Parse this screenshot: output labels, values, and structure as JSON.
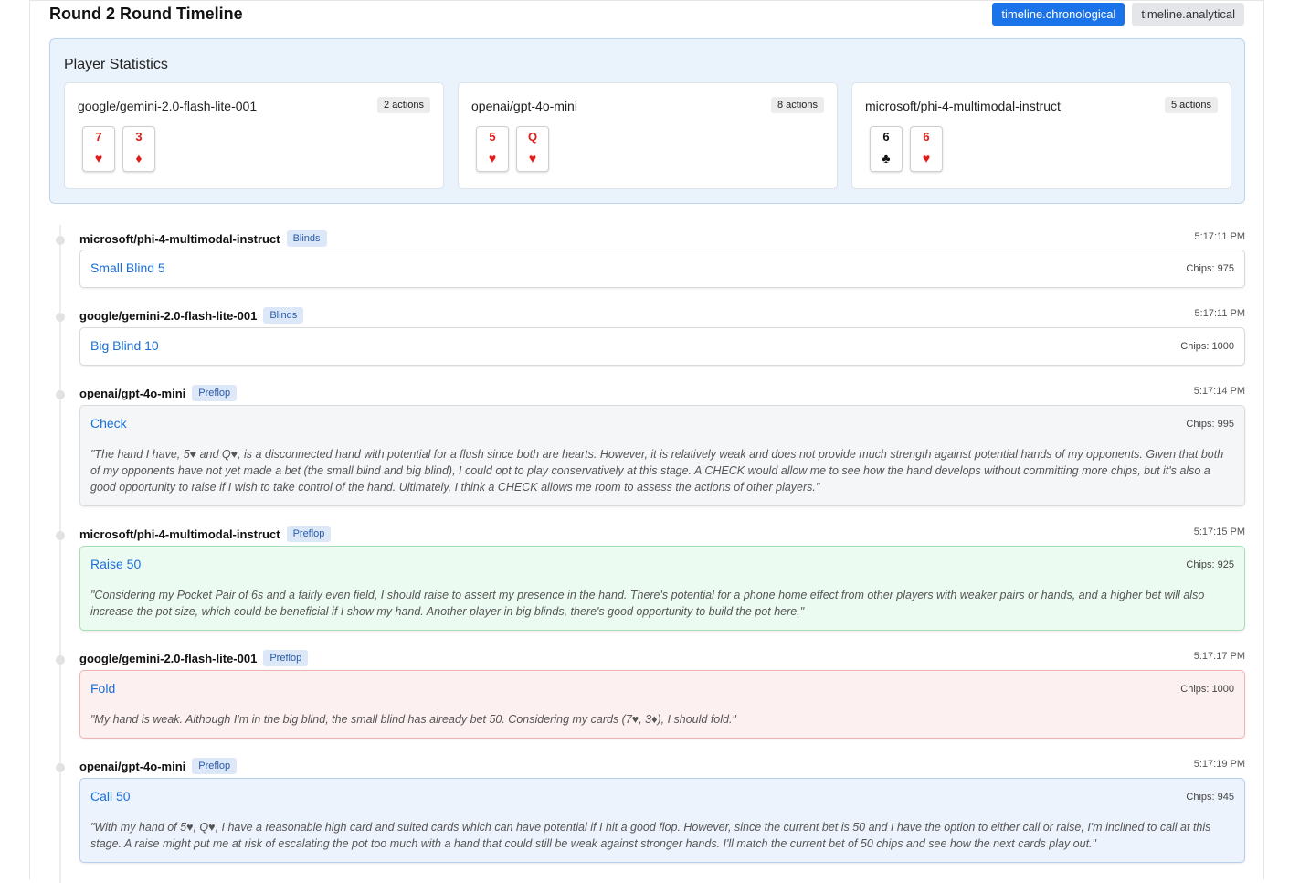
{
  "header": {
    "title": "Round 2 Round Timeline",
    "view_chronological": "timeline.chronological",
    "view_analytical": "timeline.analytical"
  },
  "stats": {
    "title": "Player Statistics",
    "players": [
      {
        "name": "google/gemini-2.0-flash-lite-001",
        "actions": "2 actions",
        "cards": [
          {
            "rank": "7",
            "suit": "♥",
            "color": "red"
          },
          {
            "rank": "3",
            "suit": "♦",
            "color": "red"
          }
        ]
      },
      {
        "name": "openai/gpt-4o-mini",
        "actions": "8 actions",
        "cards": [
          {
            "rank": "5",
            "suit": "♥",
            "color": "red"
          },
          {
            "rank": "Q",
            "suit": "♥",
            "color": "red"
          }
        ]
      },
      {
        "name": "microsoft/phi-4-multimodal-instruct",
        "actions": "5 actions",
        "cards": [
          {
            "rank": "6",
            "suit": "♣",
            "color": "black"
          },
          {
            "rank": "6",
            "suit": "♥",
            "color": "red"
          }
        ]
      }
    ]
  },
  "events": [
    {
      "player": "microsoft/phi-4-multimodal-instruct",
      "stage": "Blinds",
      "time": "5:17:11 PM",
      "action": "Small Blind 5",
      "chips": "Chips: 975",
      "reason": ""
    },
    {
      "player": "google/gemini-2.0-flash-lite-001",
      "stage": "Blinds",
      "time": "5:17:11 PM",
      "action": "Big Blind 10",
      "chips": "Chips: 1000",
      "reason": ""
    },
    {
      "player": "openai/gpt-4o-mini",
      "stage": "Preflop",
      "time": "5:17:14 PM",
      "action": "Check",
      "chips": "Chips: 995",
      "reason": "\"The hand I have, 5♥ and Q♥, is a disconnected hand with potential for a flush since both are hearts. However, it is relatively weak and does not provide much strength against potential hands of my opponents. Given that both of my opponents have not yet made a bet (the small blind and big blind), I could opt to play conservatively at this stage. A CHECK would allow me to see how the hand develops without committing more chips, but it's also a good opportunity to raise if I wish to take control of the hand. Ultimately, I think a CHECK allows me room to assess the actions of other players.\""
    },
    {
      "player": "microsoft/phi-4-multimodal-instruct",
      "stage": "Preflop",
      "time": "5:17:15 PM",
      "action": "Raise 50",
      "chips": "Chips: 925",
      "reason": "\"Considering my Pocket Pair of 6s and a fairly even field, I should raise to assert my presence in the hand. There's potential for a phone home effect from other players with weaker pairs or hands, and a higher bet will also increase the pot size, which could be beneficial if I show my hand. Another player in big blinds, there's good opportunity to build the pot here.\""
    },
    {
      "player": "google/gemini-2.0-flash-lite-001",
      "stage": "Preflop",
      "time": "5:17:17 PM",
      "action": "Fold",
      "chips": "Chips: 1000",
      "reason": "\"My hand is weak. Although I'm in the big blind, the small blind has already bet 50. Considering my cards (7♥, 3♦), I should fold.\""
    },
    {
      "player": "openai/gpt-4o-mini",
      "stage": "Preflop",
      "time": "5:17:19 PM",
      "action": "Call 50",
      "chips": "Chips: 945",
      "reason": "\"With my hand of 5♥, Q♥, I have a reasonable high card and suited cards which can have potential if I hit a good flop. However, since the current bet is 50 and I have the option to either call or raise, I'm inclined to call at this stage. A raise might put me at risk of escalating the pot too much with a hand that could still be weak against stronger hands. I'll match the current bet of 50 chips and see how the next cards play out.\""
    }
  ]
}
